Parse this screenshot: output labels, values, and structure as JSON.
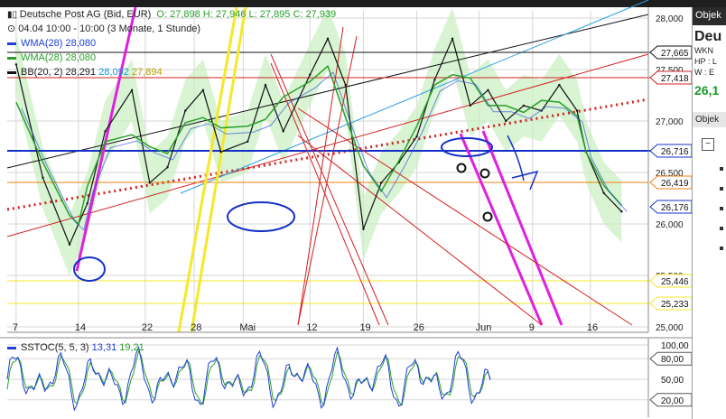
{
  "instrument": {
    "name": "Deutsche Post AG (Bid, EUR)",
    "ohlc": "O: 27,898  H: 27,946  L: 27,895  C: 27,939",
    "info": "04.04 10:00 - 10:00 (3 Monate, 1 Stunde)"
  },
  "indicators": [
    {
      "label": "WMA(28) 28,080",
      "color": "#1f3fd6"
    },
    {
      "label": "WMA(28) 28,080",
      "color": "#2aa02a"
    },
    {
      "label": "BB(20, 2) 28,291",
      "extra1": "28,092",
      "extra2": "27,894",
      "color": "#111111",
      "c1": "#1a9bd6",
      "c2": "#b5a400"
    }
  ],
  "oscillator": {
    "label": "SSTOC(5, 5, 3)",
    "v1": "13,31",
    "v2": "19,21",
    "c1": "#1f3fd6",
    "c2": "#2aa02a"
  },
  "side_panel": {
    "header": "Objek",
    "title": "Deu",
    "wkn": "WKN",
    "hp": "HP : L",
    "w": "W : E",
    "price": "26,1",
    "header2": "Objek",
    "collapse": "−"
  },
  "colors": {
    "grid": "#d6d6d6",
    "axis": "#8a8a8a",
    "price": "#111111",
    "band": "#c8f0c0",
    "wma_green": "#2aa02a",
    "wma_blue": "#1f3fd6",
    "magenta": "#e020e0",
    "yellow": "#f5e82a",
    "red": "#d42020",
    "navy": "#1430c8",
    "cyan": "#2aa0e0",
    "orange": "#f08010"
  },
  "chart_data": {
    "type": "line",
    "title": "Deutsche Post AG (Bid, EUR)",
    "xlabel": "",
    "ylabel": "",
    "ylim": [
      25000,
      28000
    ],
    "y_ticks": [
      "28,000",
      "27,500",
      "27,000",
      "26,500",
      "26,000",
      "25,500",
      "25,000"
    ],
    "x_ticks": [
      "7",
      "14",
      "22",
      "28",
      "Mai",
      "12",
      "19",
      "26",
      "Jun",
      "9",
      "16"
    ],
    "price_series": {
      "name": "Deutsche Post AG",
      "x": [
        7,
        10,
        13,
        14,
        15,
        17,
        20,
        22,
        24,
        26,
        28,
        30,
        33,
        35,
        37,
        40,
        42,
        44,
        46,
        48,
        50,
        52,
        54,
        56,
        58,
        60,
        62,
        64,
        66,
        68,
        70,
        71,
        73,
        75
      ],
      "y": [
        27550,
        26450,
        25800,
        26000,
        26200,
        26900,
        27300,
        26400,
        26550,
        27100,
        27300,
        26700,
        26800,
        27350,
        26900,
        27450,
        27800,
        27350,
        25950,
        26400,
        26600,
        26850,
        27400,
        27800,
        27150,
        27300,
        27000,
        27150,
        27100,
        27350,
        27100,
        26700,
        26300,
        26120
      ]
    },
    "horizontal_levels": [
      {
        "value": 27665,
        "label": "27,665",
        "color": "#111111"
      },
      {
        "value": 27418,
        "label": "27,418",
        "color": "#d42020"
      },
      {
        "value": 26716,
        "label": "26,716",
        "color": "#1430c8"
      },
      {
        "value": 26419,
        "label": "26,419",
        "color": "#f08010"
      },
      {
        "value": 26176,
        "label": "26,176",
        "color": "#1430c8"
      },
      {
        "value": 25446,
        "label": "25,446",
        "color": "#f5e82a"
      },
      {
        "value": 25233,
        "label": "25,233",
        "color": "#f5e82a"
      }
    ],
    "oscillator": {
      "name": "SSTOC(5, 5, 3)",
      "ylim": [
        0,
        100
      ],
      "y_ticks": [
        "100,00",
        "80,00",
        "50,00",
        "20,00"
      ],
      "levels": [
        {
          "value": 80,
          "label": "80,00"
        },
        {
          "value": 20,
          "label": "20,00"
        }
      ]
    }
  }
}
